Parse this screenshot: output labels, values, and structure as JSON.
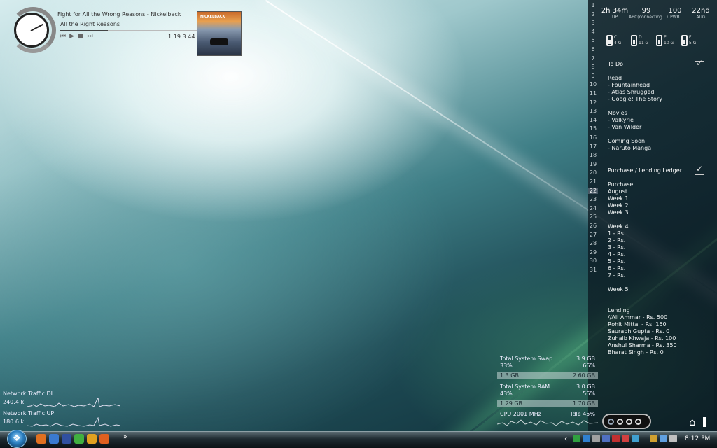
{
  "player": {
    "title": "Fight for All the Wrong Reasons - Nickelback",
    "album": "All the Right Reasons",
    "time": "1:19 3:44",
    "progress": 0.35,
    "controls": [
      "⏮",
      "▶",
      "■",
      "⏭"
    ],
    "album_logo": "NICKELBACK"
  },
  "stats": [
    {
      "value": "2h 34m",
      "label": "UP"
    },
    {
      "value": "99",
      "label": "ABC(connecting...)"
    },
    {
      "value": "100",
      "label": "PWR"
    },
    {
      "value": "22nd",
      "label": "AUG"
    }
  ],
  "drives": [
    {
      "letter": "C",
      "size": "4 G"
    },
    {
      "letter": "D",
      "size": "11 G"
    },
    {
      "letter": "E",
      "size": "10 G"
    },
    {
      "letter": "F",
      "size": "5 G"
    }
  ],
  "calendar": {
    "days": [
      "1",
      "2",
      "3",
      "4",
      "5",
      "6",
      "7",
      "8",
      "9",
      "10",
      "11",
      "12",
      "13",
      "14",
      "15",
      "16",
      "17",
      "18",
      "19",
      "20",
      "21",
      "22",
      "23",
      "24",
      "25",
      "26",
      "27",
      "28",
      "29",
      "30",
      "31"
    ],
    "today": "22"
  },
  "todo": {
    "title": "To Do",
    "text": "Read\n- Fountainhead\n- Atlas Shrugged\n- Google! The Story\n\nMovies\n- Valkyrie\n- Van Wilder\n\nComing Soon\n- Naruto Manga"
  },
  "ledger": {
    "title": "Purchase / Lending Ledger",
    "text": "Purchase\nAugust\nWeek 1\nWeek 2\nWeek 3\n\nWeek 4\n1 - Rs.\n2 - Rs.\n3 - Rs.\n4 - Rs.\n5 - Rs.\n6 - Rs.\n7 - Rs.\n\nWeek 5\n\n\nLending\n//Ali Ammar - Rs. 500\nRohit Mittal - Rs. 150\nSaurabh Gupta - Rs. 0\nZuhaib Khwaja - Rs. 100\nAnshul Sharma - Rs. 350\nBharat Singh - Rs. 0"
  },
  "system": {
    "swap_label": "Total System Swap:",
    "swap_total": "3.9 GB",
    "swap_pct_a": "33%",
    "swap_pct_b": "66%",
    "swap_used": "1.3 GB",
    "swap_free": "2.60 GB",
    "ram_label": "Total System RAM:",
    "ram_total": "3.0 GB",
    "ram_pct_a": "43%",
    "ram_pct_b": "56%",
    "ram_used": "1.29 GB",
    "ram_free": "1.70 GB",
    "cpu": "CPU 2001 MHz",
    "idle": "Idle 45%"
  },
  "network": {
    "dl_label": "Network Traffic DL",
    "dl_value": "240.4 k",
    "up_label": "Network Traffic UP",
    "up_value": "180.6 k"
  },
  "taskbar": {
    "quicklaunch_colors": [
      "#e07020",
      "#3a7ad0",
      "#3050a0",
      "#40b040",
      "#e0a020",
      "#e06020"
    ],
    "chevron": "»",
    "tray_chevron": "‹",
    "tray_colors": [
      "#30a040",
      "#3080d0",
      "#a0a0a0",
      "#5070c0",
      "#c03030",
      "#d04040",
      "#40a0d0",
      "#d0a030",
      "#60a0e0",
      "#c0c0c0"
    ],
    "clock": "8:12 PM"
  },
  "colors": {
    "panel": "#0a161e",
    "accent": "#9aa6aa"
  }
}
